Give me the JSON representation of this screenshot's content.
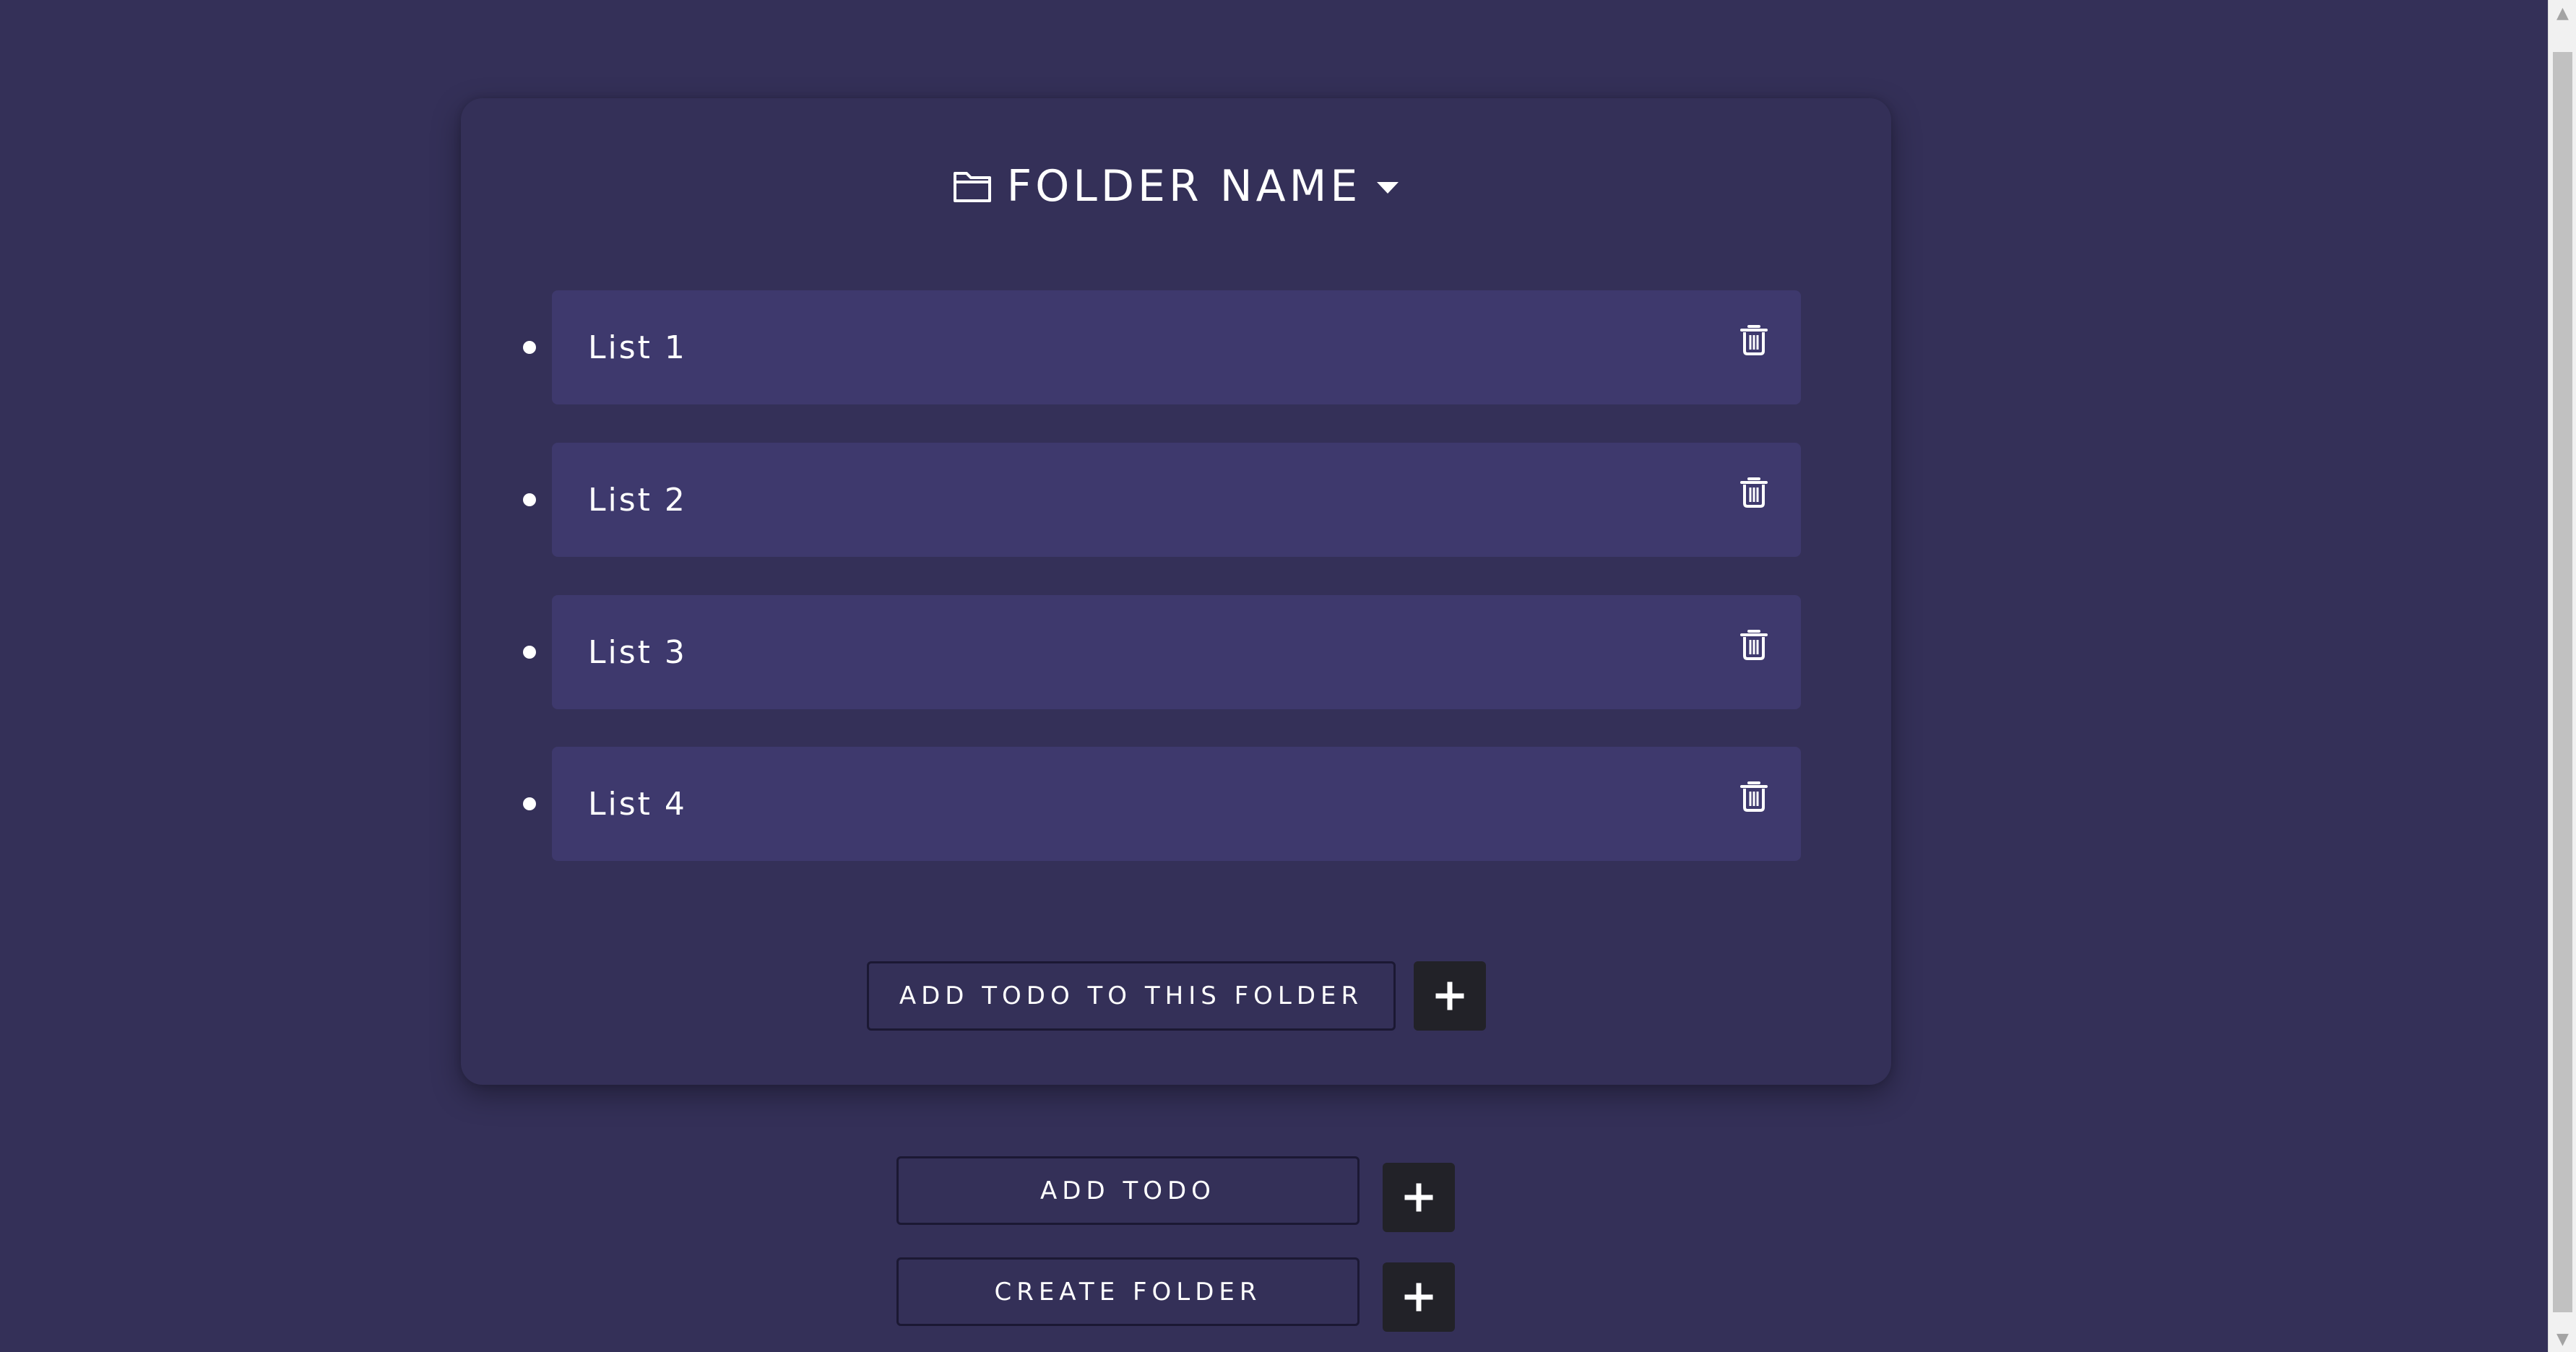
{
  "folder": {
    "title": "FOLDER NAME",
    "icon": "folder-outline-icon",
    "dropdown_icon": "caret-down-icon",
    "lists": [
      {
        "label": "List 1",
        "delete_icon": "trash-icon"
      },
      {
        "label": "List 2",
        "delete_icon": "trash-icon"
      },
      {
        "label": "List 3",
        "delete_icon": "trash-icon"
      },
      {
        "label": "List 4",
        "delete_icon": "trash-icon"
      }
    ],
    "add_todo_label": "ADD TODO TO THIS FOLDER"
  },
  "actions": {
    "add_todo_label": "ADD TODO",
    "create_folder_label": "CREATE FOLDER",
    "plus_icon": "plus-icon"
  },
  "colors": {
    "background": "#343058",
    "list_item": "#3e396d",
    "plus_button": "#222228",
    "button_border": "#1b1833",
    "text": "#ffffff"
  }
}
